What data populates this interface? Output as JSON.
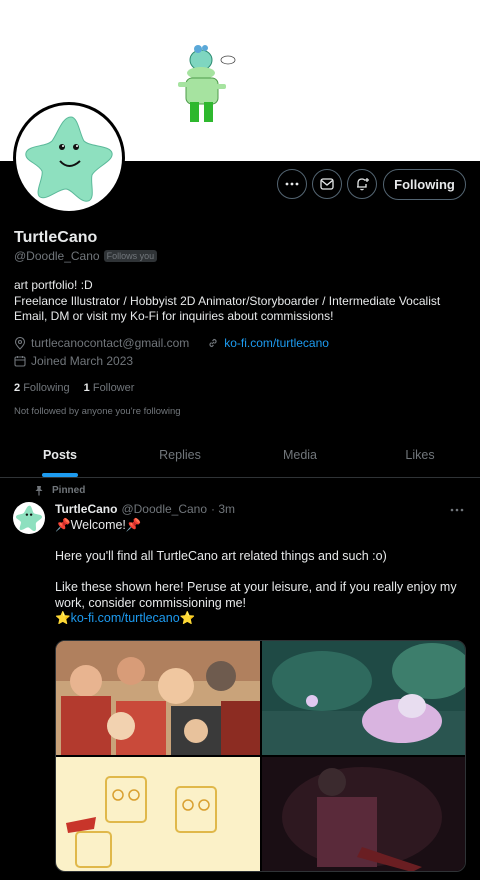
{
  "profile": {
    "display_name": "TurtleCano",
    "handle": "@Doodle_Cano",
    "follows_you_badge": "Follows you",
    "bio": "art portfolio! :D\nFreelance Illustrator / Hobbyist 2D Animator/Storyboarder / Intermediate Vocalist\nEmail, DM or visit my Ko-Fi for inquiries about commissions!",
    "email": "turtlecanocontact@gmail.com",
    "website": "ko-fi.com/turtlecano",
    "joined": "Joined March 2023",
    "following_count": "2",
    "following_label": "Following",
    "followers_count": "1",
    "followers_label": "Follower",
    "not_followed_text": "Not followed by anyone you're following",
    "follow_button_label": "Following"
  },
  "tabs": [
    {
      "label": "Posts",
      "active": true
    },
    {
      "label": "Replies",
      "active": false
    },
    {
      "label": "Media",
      "active": false
    },
    {
      "label": "Likes",
      "active": false
    }
  ],
  "pinned_tweet": {
    "pinned_label": "Pinned",
    "author_name": "TurtleCano",
    "author_handle": "@Doodle_Cano",
    "time": "· 3m",
    "line1": "📌Welcome!📌",
    "line2": "Here you'll find all TurtleCano art related things and such :o)",
    "line3": "Like these shown here! Peruse at your leisure, and if you really enjoy my work, consider commissioning me!",
    "link_prefix": "⭐",
    "link_text": "ko-fi.com/turtlecano",
    "link_suffix": "⭐"
  },
  "colors": {
    "background": "#000000",
    "accent": "#1d9bf0",
    "text_primary": "#e7e9ea",
    "text_secondary": "#71767b",
    "border": "#2f3336",
    "avatar_star": "#8ee0bf"
  },
  "icons": {
    "more": "more-icon",
    "message": "mail-icon",
    "notify": "bell-plus-icon",
    "location": "location-icon",
    "link": "link-icon",
    "calendar": "calendar-icon",
    "pin": "pin-icon"
  }
}
